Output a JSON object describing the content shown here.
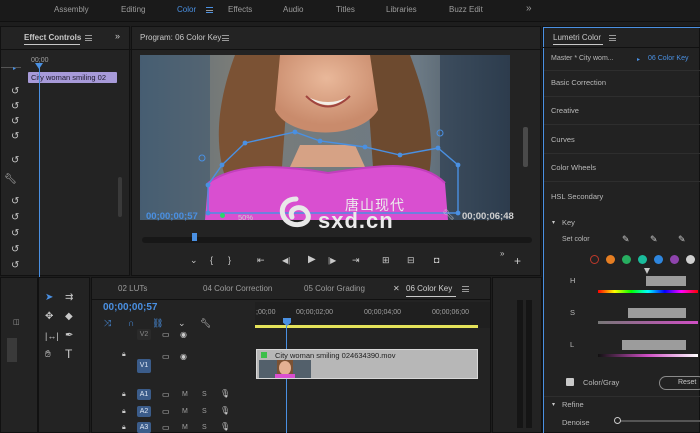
{
  "workspaces": {
    "items": [
      "Assembly",
      "Editing",
      "Color",
      "Effects",
      "Audio",
      "Titles",
      "Libraries",
      "Buzz Edit"
    ],
    "active": "Color",
    "more": "»"
  },
  "effect_controls": {
    "title": "Effect Controls",
    "ruler_time": "00;00",
    "clip_label": "City woman smiling 02"
  },
  "program": {
    "title": "Program: 06 Color Key",
    "timecode_left": "00;00;00;57",
    "zoom": "50%",
    "timecode_right": "00;00;06;48"
  },
  "watermark": {
    "logo": "sxd.cn",
    "chinese": "唐山现代"
  },
  "lumetri": {
    "title": "Lumetri Color",
    "master_label": "Master * City wom...",
    "sequence_link": "06 Color Key",
    "sections": [
      "Basic Correction",
      "Creative",
      "Curves",
      "Color Wheels",
      "HSL Secondary"
    ],
    "key_label": "Key",
    "set_color": "Set color",
    "slider_labels": [
      "H",
      "S",
      "L"
    ],
    "color_gray": "Color/Gray",
    "reset": "Reset",
    "refine": "Refine",
    "denoise": "Denoise",
    "swatch_colors": [
      "#c0392b",
      "#e67e22",
      "#27ae60",
      "#1abc9c",
      "#2e86de",
      "#8e44ad",
      "#d0d0d0"
    ]
  },
  "timeline": {
    "tabs": [
      "02 LUTs",
      "04 Color Correction",
      "05 Color Grading",
      "06 Color Key"
    ],
    "active_tab": "06 Color Key",
    "timecode": "00;00;00;57",
    "ruler_labels": [
      ";00;00",
      "00;00;02;00",
      "00;00;04;00",
      "00;00;06;00"
    ],
    "tracks": [
      "V2",
      "V1",
      "A1",
      "A2",
      "A3"
    ],
    "clip_name": "City woman smiling 024634390.mov",
    "track_m": "M",
    "track_s": "S"
  },
  "colors": {
    "accent": "#4a90e2",
    "clip_purple": "#a79ad9",
    "panel_bg": "#232323"
  }
}
